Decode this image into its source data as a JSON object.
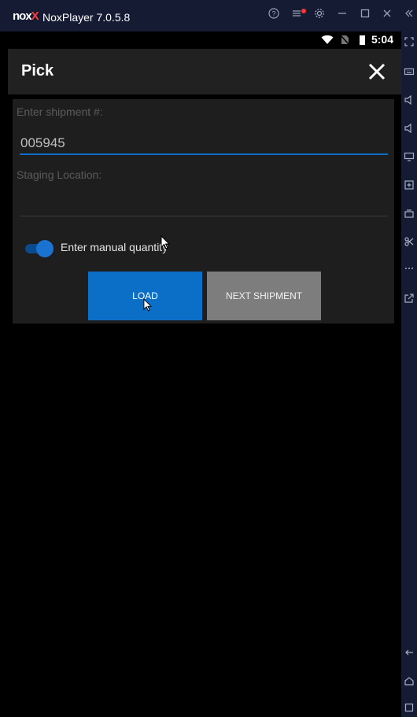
{
  "window": {
    "title": "NoxPlayer 7.0.5.8",
    "logo_text": "nox",
    "logo_accent": "X"
  },
  "status_bar": {
    "time": "5:04",
    "icons": [
      "wifi-icon",
      "no-sim-icon",
      "battery-icon"
    ]
  },
  "app_bar": {
    "title": "Pick",
    "close_icon": "close-icon"
  },
  "form": {
    "shipment_label": "Enter shipment #:",
    "shipment_value": "005945",
    "staging_label": "Staging Location:",
    "staging_value": "",
    "manual_qty_label": "Enter manual quantity",
    "manual_qty_on": true
  },
  "buttons": {
    "load": "LOAD",
    "next_shipment": "NEXT SHIPMENT"
  },
  "colors": {
    "accent": "#0b6fc8",
    "titlebar": "#151b33",
    "appbar": "#212121",
    "panel": "#1e1e1e"
  }
}
